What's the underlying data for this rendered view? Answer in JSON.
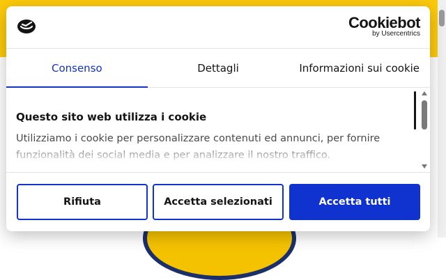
{
  "colors": {
    "accent": "#1032cf",
    "background_band": "#fcca0b",
    "text": "#141414"
  },
  "header": {
    "logo_icon": "cookie-consent-logo-icon",
    "brand_name": "Cookiebot",
    "brand_sub": "by Usercentrics"
  },
  "tabs": [
    {
      "label": "Consenso",
      "active": true
    },
    {
      "label": "Dettagli",
      "active": false
    },
    {
      "label": "Informazioni sui cookie",
      "active": false
    }
  ],
  "content": {
    "title": "Questo sito web utilizza i cookie",
    "body": "Utilizziamo i cookie per personalizzare contenuti ed annunci, per fornire funzionalità dei social media e per analizzare il nostro traffico."
  },
  "buttons": {
    "deny": "Rifiuta",
    "allow_selected": "Accetta selezionati",
    "allow_all": "Accetta tutti"
  }
}
